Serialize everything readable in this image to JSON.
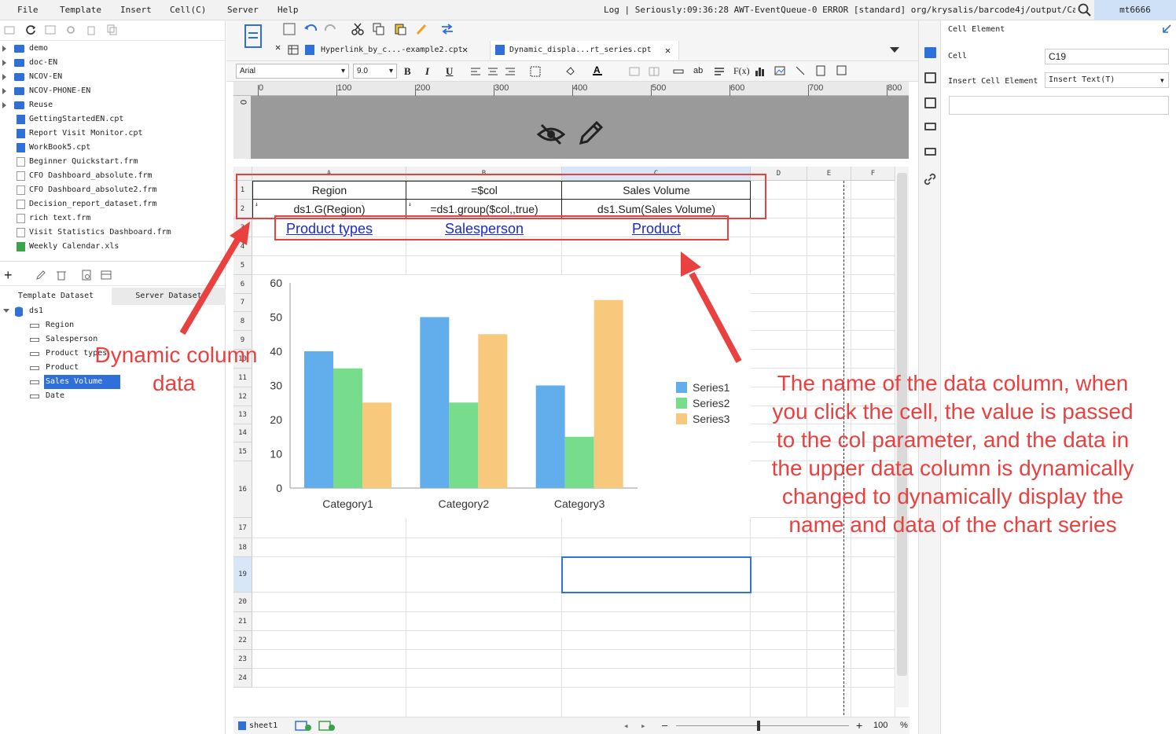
{
  "menu": [
    "File",
    "Template",
    "Insert",
    "Cell(C)",
    "Server",
    "Help"
  ],
  "log": "Log | Seriously:09:36:28 AWT-EventQueue-0 ERROR [standard] org/krysalis/barcode4j/output/CanvasPr...",
  "user": "mt6666",
  "files": [
    {
      "name": "demo",
      "type": "folder"
    },
    {
      "name": "doc-EN",
      "type": "folder"
    },
    {
      "name": "NCOV-EN",
      "type": "folder"
    },
    {
      "name": "NCOV-PHONE-EN",
      "type": "folder"
    },
    {
      "name": "Reuse",
      "type": "folder"
    },
    {
      "name": "GettingStartedEN.cpt",
      "type": "cpt"
    },
    {
      "name": "Report Visit Monitor.cpt",
      "type": "cpt"
    },
    {
      "name": "WorkBook5.cpt",
      "type": "cpt"
    },
    {
      "name": "Beginner Quickstart.frm",
      "type": "frm"
    },
    {
      "name": "CFO Dashboard_absolute.frm",
      "type": "frm"
    },
    {
      "name": "CFO Dashboard_absolute2.frm",
      "type": "frm"
    },
    {
      "name": "Decision_report_dataset.frm",
      "type": "frm"
    },
    {
      "name": "rich text.frm",
      "type": "frm"
    },
    {
      "name": "Visit Statistics Dashboard.frm",
      "type": "frm"
    },
    {
      "name": "Weekly Calendar.xls",
      "type": "xls"
    }
  ],
  "dataset_tabs": [
    "Template Dataset",
    "Server Dataset"
  ],
  "dataset": {
    "name": "ds1",
    "fields": [
      "Region",
      "Salesperson",
      "Product types",
      "Product",
      "Sales Volume",
      "Date"
    ],
    "selected": "Sales Volume"
  },
  "file_tabs": [
    "Hyperlink_by_c...-example2.cpt",
    "Dynamic_displa...rt_series.cpt"
  ],
  "font": {
    "name": "Arial",
    "size": "9.0"
  },
  "format_buttons": [
    "B",
    "I",
    "U"
  ],
  "ruler_labels": [
    "0",
    "100",
    "200",
    "300",
    "400",
    "500",
    "600",
    "700",
    "800"
  ],
  "columns": [
    "A",
    "B",
    "C",
    "D",
    "E",
    "F"
  ],
  "rows": [
    "1",
    "2",
    "3",
    "4",
    "5",
    "6",
    "7",
    "8",
    "9",
    "10",
    "11",
    "12",
    "13",
    "14",
    "15",
    "16",
    "17",
    "18",
    "19",
    "20",
    "21",
    "22",
    "23",
    "24"
  ],
  "cells": {
    "A1": "Region",
    "B1": "=$col",
    "C1": "Sales Volume",
    "A2": "ds1.G(Region)",
    "B2": "=ds1.group($col,,true)",
    "C2": "ds1.Sum(Sales Volume)",
    "A3": "Product types",
    "B3": "Salesperson",
    "C3": "Product"
  },
  "annotations": {
    "left": [
      "Dynamic column",
      "data"
    ],
    "right": [
      "The name of the data column, when",
      "you click the cell, the value is passed",
      "to the col parameter, and the data in",
      "the upper data column is dynamically",
      "changed to dynamically display the",
      "name and data of the chart series"
    ]
  },
  "right_panel": {
    "title": "Cell Element",
    "cell_label": "Cell",
    "cell_value": "C19",
    "insert_label": "Insert Cell Element",
    "insert_value": "Insert Text(T)"
  },
  "status": {
    "sheet": "sheet1",
    "zoom": "100",
    "zoom_unit": "%",
    "minus": "—",
    "plus": "+"
  },
  "colors": {
    "series1": "#62aeed",
    "series2": "#77dc8c",
    "series3": "#f8c97c",
    "annot": "#e8413f",
    "link": "#1a29d6"
  },
  "chart_data": {
    "type": "bar",
    "categories": [
      "Category1",
      "Category2",
      "Category3"
    ],
    "series": [
      {
        "name": "Series1",
        "values": [
          40,
          50,
          30
        ]
      },
      {
        "name": "Series2",
        "values": [
          35,
          25,
          15
        ]
      },
      {
        "name": "Series3",
        "values": [
          25,
          45,
          55
        ]
      }
    ],
    "ylim": [
      0,
      60
    ],
    "yticks": [
      0,
      10,
      20,
      30,
      40,
      50,
      60
    ],
    "legend": "right",
    "grid": false
  }
}
